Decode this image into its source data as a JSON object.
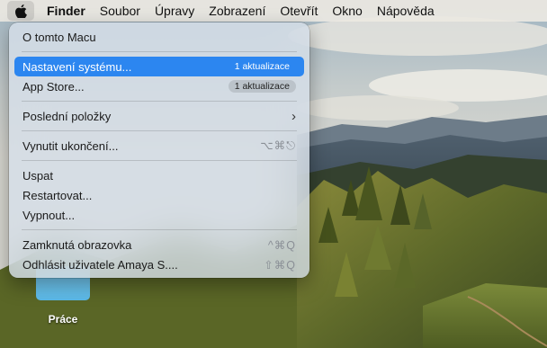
{
  "menubar": {
    "app_name": "Finder",
    "items": [
      "Soubor",
      "Úpravy",
      "Zobrazení",
      "Otevřít",
      "Okno",
      "Nápověda"
    ]
  },
  "apple_menu": {
    "about": "O tomto Macu",
    "system_settings": "Nastavení systému...",
    "system_settings_badge": "1 aktualizace",
    "app_store": "App Store...",
    "app_store_badge": "1 aktualizace",
    "recent_items": "Poslední položky",
    "force_quit": "Vynutit ukončení...",
    "force_quit_shortcut": "⌥⌘⎋",
    "sleep": "Uspat",
    "restart": "Restartovat...",
    "shutdown": "Vypnout...",
    "lock_screen": "Zamknutá obrazovka",
    "lock_screen_shortcut": "^⌘Q",
    "logout": "Odhlásit uživatele Amaya S....",
    "logout_shortcut": "⇧⌘Q"
  },
  "desktop": {
    "folder_label": "Práce"
  },
  "colors": {
    "highlight": "#2c86f0",
    "folder": "#6cc4ee"
  }
}
